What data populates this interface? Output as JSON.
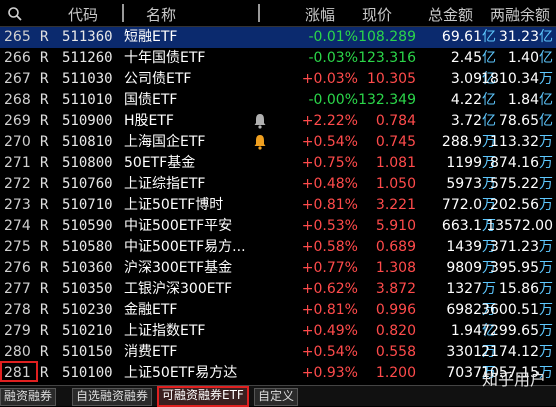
{
  "header": {
    "search_icon": "search-icon",
    "code": "代码",
    "name": "名称",
    "change": "涨幅",
    "price": "现价",
    "amount": "总金额",
    "balance": "两融余额"
  },
  "rows": [
    {
      "idx": "265",
      "flag": "R",
      "code": "511360",
      "name": "短融ETF",
      "chg": "-0.01%",
      "dir": "dn",
      "price": "108.289",
      "amt": "69.61",
      "amt_unit": "亿",
      "bal": "31.23",
      "bal_unit": "亿",
      "selected": true,
      "bell": false
    },
    {
      "idx": "266",
      "flag": "R",
      "code": "511260",
      "name": "十年国债ETF",
      "chg": "-0.03%",
      "dir": "dn",
      "price": "123.316",
      "amt": "2.45",
      "amt_unit": "亿",
      "bal": "1.40",
      "bal_unit": "亿",
      "selected": false,
      "bell": false
    },
    {
      "idx": "267",
      "flag": "R",
      "code": "511030",
      "name": "公司债ETF",
      "chg": "+0.03%",
      "dir": "up",
      "price": "10.305",
      "amt": "3.09",
      "amt_unit": "亿",
      "bal": "1810.34",
      "bal_unit": "万",
      "selected": false,
      "bell": false
    },
    {
      "idx": "268",
      "flag": "R",
      "code": "511010",
      "name": "国债ETF",
      "chg": "-0.00%",
      "dir": "dn",
      "price": "132.349",
      "amt": "4.22",
      "amt_unit": "亿",
      "bal": "1.84",
      "bal_unit": "亿",
      "selected": false,
      "bell": false
    },
    {
      "idx": "269",
      "flag": "R",
      "code": "510900",
      "name": "H股ETF",
      "chg": "+2.22%",
      "dir": "up",
      "price": "0.784",
      "amt": "3.72",
      "amt_unit": "亿",
      "bal": "78.65",
      "bal_unit": "亿",
      "selected": false,
      "bell": true,
      "bell_color": "#b0b0b0"
    },
    {
      "idx": "270",
      "flag": "R",
      "code": "510810",
      "name": "上海国企ETF",
      "chg": "+0.54%",
      "dir": "up",
      "price": "0.745",
      "amt": "288.9",
      "amt_unit": "万",
      "bal": "113.32",
      "bal_unit": "万",
      "selected": false,
      "bell": true,
      "bell_color": "#f0a020"
    },
    {
      "idx": "271",
      "flag": "R",
      "code": "510800",
      "name": "50ETF基金",
      "chg": "+0.75%",
      "dir": "up",
      "price": "1.081",
      "amt": "1199",
      "amt_unit": "万",
      "bal": "874.16",
      "bal_unit": "万",
      "selected": false,
      "bell": false
    },
    {
      "idx": "272",
      "flag": "R",
      "code": "510760",
      "name": "上证综指ETF",
      "chg": "+0.48%",
      "dir": "up",
      "price": "1.050",
      "amt": "5973",
      "amt_unit": "万",
      "bal": "575.22",
      "bal_unit": "万",
      "selected": false,
      "bell": false
    },
    {
      "idx": "273",
      "flag": "R",
      "code": "510710",
      "name": "上证50ETF博时",
      "chg": "+0.81%",
      "dir": "up",
      "price": "3.221",
      "amt": "772.0",
      "amt_unit": "万",
      "bal": "202.56",
      "bal_unit": "万",
      "selected": false,
      "bell": false
    },
    {
      "idx": "274",
      "flag": "R",
      "code": "510590",
      "name": "中证500ETF平安",
      "chg": "+0.53%",
      "dir": "up",
      "price": "5.910",
      "amt": "663.1",
      "amt_unit": "万",
      "bal": "13572.00",
      "bal_unit": "",
      "selected": false,
      "bell": false
    },
    {
      "idx": "275",
      "flag": "R",
      "code": "510580",
      "name": "中证500ETF易方...",
      "chg": "+0.58%",
      "dir": "up",
      "price": "0.689",
      "amt": "1439",
      "amt_unit": "万",
      "bal": "371.23",
      "bal_unit": "万",
      "selected": false,
      "bell": false
    },
    {
      "idx": "276",
      "flag": "R",
      "code": "510360",
      "name": "沪深300ETF基金",
      "chg": "+0.77%",
      "dir": "up",
      "price": "1.308",
      "amt": "9809",
      "amt_unit": "万",
      "bal": "395.95",
      "bal_unit": "万",
      "selected": false,
      "bell": false
    },
    {
      "idx": "277",
      "flag": "R",
      "code": "510350",
      "name": "工银沪深300ETF",
      "chg": "+0.62%",
      "dir": "up",
      "price": "3.872",
      "amt": "1327",
      "amt_unit": "万",
      "bal": "15.86",
      "bal_unit": "万",
      "selected": false,
      "bell": false
    },
    {
      "idx": "278",
      "flag": "R",
      "code": "510230",
      "name": "金融ETF",
      "chg": "+0.81%",
      "dir": "up",
      "price": "0.996",
      "amt": "6982",
      "amt_unit": "万",
      "bal": "3600.51",
      "bal_unit": "万",
      "selected": false,
      "bell": false
    },
    {
      "idx": "279",
      "flag": "R",
      "code": "510210",
      "name": "上证指数ETF",
      "chg": "+0.49%",
      "dir": "up",
      "price": "0.820",
      "amt": "1.94",
      "amt_unit": "亿",
      "bal": "7299.65",
      "bal_unit": "万",
      "selected": false,
      "bell": false
    },
    {
      "idx": "280",
      "flag": "R",
      "code": "510150",
      "name": "消费ETF",
      "chg": "+0.54%",
      "dir": "up",
      "price": "0.558",
      "amt": "3301",
      "amt_unit": "万",
      "bal": "2174.12",
      "bal_unit": "万",
      "selected": false,
      "bell": false
    },
    {
      "idx": "281",
      "flag": "R",
      "code": "510100",
      "name": "上证50ETF易方达",
      "chg": "+0.93%",
      "dir": "up",
      "price": "1.200",
      "amt": "7037",
      "amt_unit": "万",
      "bal": "1057.15",
      "bal_unit": "万",
      "selected": false,
      "bell": false
    }
  ],
  "tabs": [
    {
      "label": "融资融券",
      "active": false
    },
    {
      "label": "自选融资融券",
      "active": false
    },
    {
      "label": "可融资融券ETF",
      "active": true
    },
    {
      "label": "自定义",
      "active": false
    }
  ],
  "watermark": "知乎用户"
}
